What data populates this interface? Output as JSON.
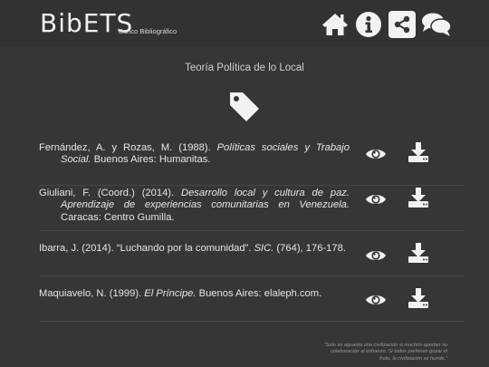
{
  "header": {
    "logo": "BibETS",
    "subtitle": "Banco Bibliográfico",
    "nav": [
      "home-icon",
      "info-icon",
      "share-icon",
      "chat-icon"
    ]
  },
  "section": {
    "title": "Teoría Política de lo Local",
    "icon": "tag-icon"
  },
  "entries": [
    {
      "before": "Fernández, A. y Rozas, M. (1988). ",
      "title": "Políticas sociales y Trabajo Social.",
      "after": " Buenos Aires: Humanitas.",
      "actions": [
        "view-icon",
        "download-icon"
      ]
    },
    {
      "before": "Giuliani, F. (Coord.) (2014). ",
      "title": "Desarrollo local y cultura de paz. Aprendizaje de experiencias comunitarias en Venezuela.",
      "after": " Caracas: Centro Gumilla.",
      "actions": [
        "view-icon",
        "download-icon"
      ]
    },
    {
      "before": "Ibarra, J. (2014). “Luchando por la comunidad”. ",
      "title": "SIC.",
      "after": " (764), 176-178.",
      "actions": [
        "view-icon",
        "download-icon"
      ]
    },
    {
      "before": "Maquiavelo, N. (1999). ",
      "title": "El Príncipe.",
      "after": " Buenos Aires: elaleph.com.",
      "actions": [
        "view-icon",
        "download-icon"
      ]
    }
  ],
  "footer": {
    "quote": "“Solo se aguanta una civilización si muchos aportan su colaboración al esfuerzo. Si todos prefieren gozar el fruto, la civilización se hunde.”"
  },
  "colors": {
    "background": "#363636",
    "header": "#323232",
    "icon": "#f2f2f2",
    "text": "#e6e6e6"
  }
}
